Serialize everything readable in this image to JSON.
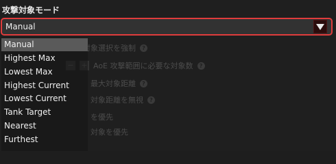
{
  "label": "攻撃対象モード",
  "combo": {
    "value": "Manual",
    "arrow_icon": "triangle-down-icon",
    "border_color": "#e13c3c"
  },
  "options": [
    {
      "label": "Manual",
      "selected": true
    },
    {
      "label": "Highest Max",
      "selected": false
    },
    {
      "label": "Lowest Max",
      "selected": false
    },
    {
      "label": "Highest Current",
      "selected": false
    },
    {
      "label": "Lowest Current",
      "selected": false
    },
    {
      "label": "Tank Target",
      "selected": false
    },
    {
      "label": "Nearest",
      "selected": false
    },
    {
      "label": "Furthest",
      "selected": false
    }
  ],
  "background_settings": [
    "有効な AoE 対象選択を強制",
    "AoE 攻撃範囲に必要な対象数",
    "最大対象距離",
    "対象距離を無視",
    "を優先",
    "対象を優先"
  ]
}
